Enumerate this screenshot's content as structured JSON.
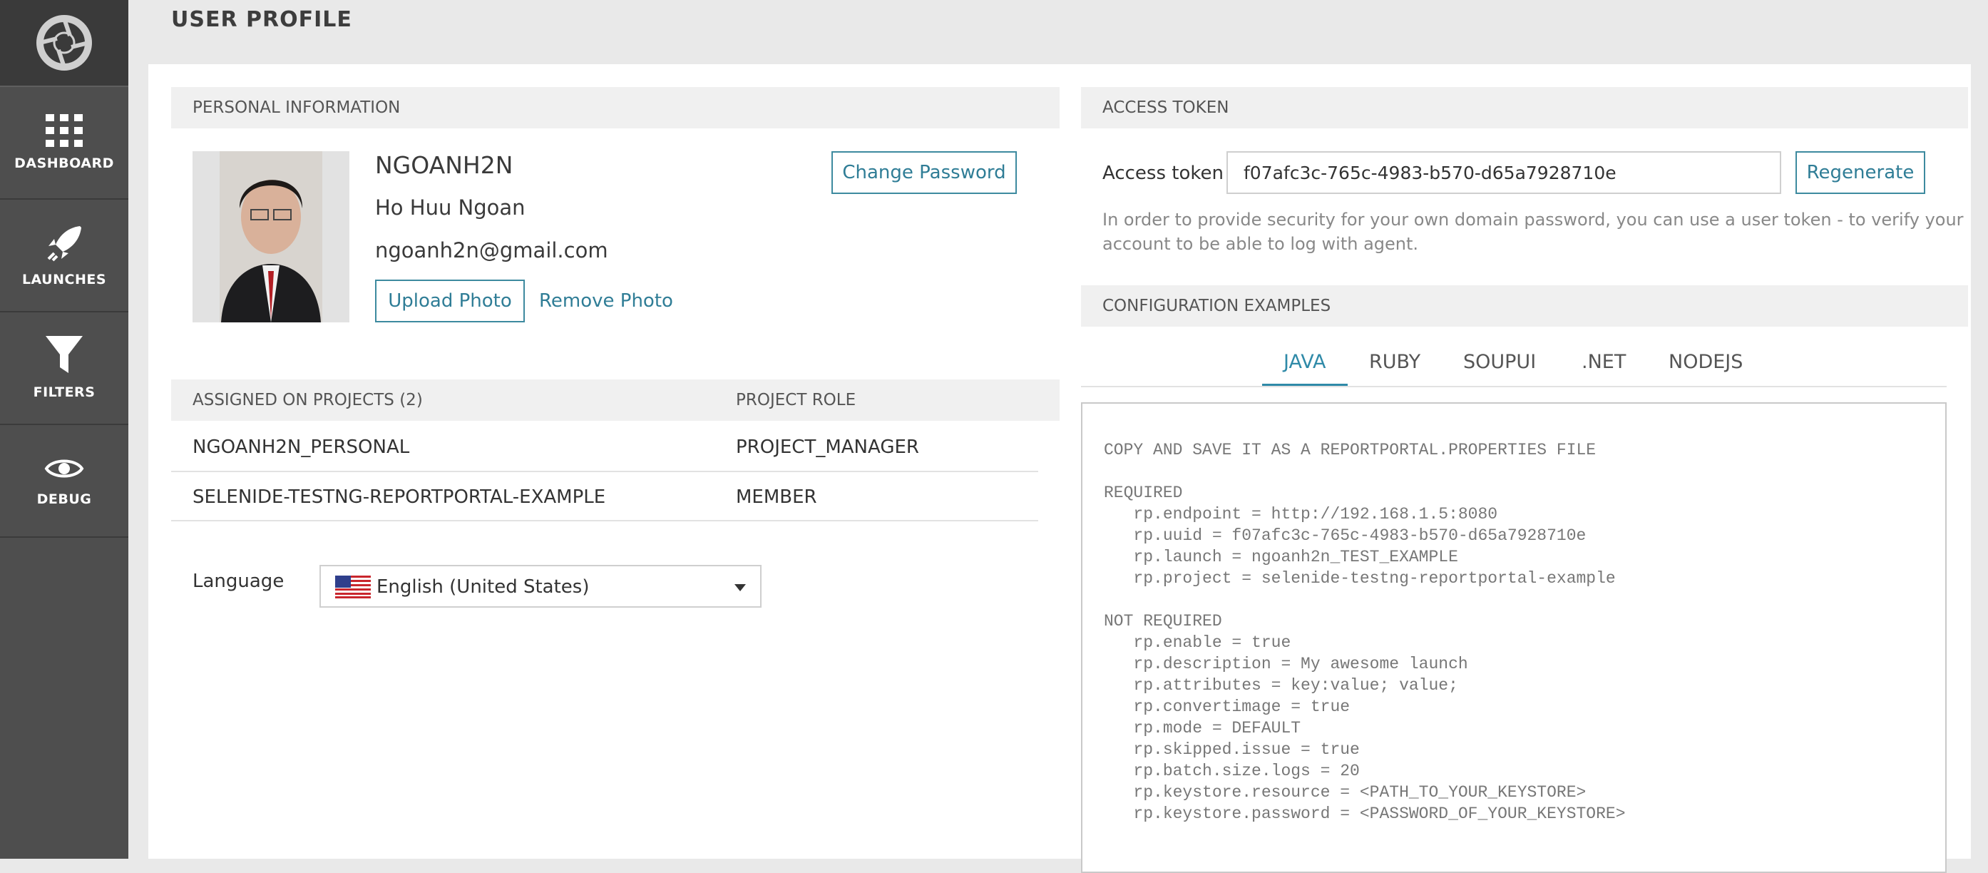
{
  "sidebar": {
    "items": [
      {
        "label": "DASHBOARD",
        "icon": "grid-icon"
      },
      {
        "label": "LAUNCHES",
        "icon": "rocket-icon"
      },
      {
        "label": "FILTERS",
        "icon": "filter-icon"
      },
      {
        "label": "DEBUG",
        "icon": "eye-icon"
      }
    ]
  },
  "header": {
    "title": "USER PROFILE"
  },
  "personal": {
    "section_title": "PERSONAL INFORMATION",
    "username": "NGOANH2N",
    "full_name": "Ho Huu Ngoan",
    "email": "ngoanh2n@gmail.com",
    "change_password": "Change Password",
    "upload_photo": "Upload Photo",
    "remove_photo": "Remove Photo"
  },
  "projects": {
    "col_project": "ASSIGNED ON PROJECTS (2)",
    "col_role": "PROJECT ROLE",
    "rows": [
      {
        "name": "NGOANH2N_PERSONAL",
        "role": "PROJECT_MANAGER"
      },
      {
        "name": "SELENIDE-TESTNG-REPORTPORTAL-EXAMPLE",
        "role": "MEMBER"
      }
    ]
  },
  "language": {
    "label": "Language",
    "value": "English (United States)"
  },
  "token": {
    "section_title": "ACCESS TOKEN",
    "label": "Access token",
    "value": "f07afc3c-765c-4983-b570-d65a7928710e",
    "regenerate": "Regenerate",
    "help_line1": "In order to provide security for your own domain password, you can use a user token - to verify your",
    "help_line2": "account to be able to log with agent."
  },
  "config": {
    "section_title": "CONFIGURATION EXAMPLES",
    "tabs": [
      "JAVA",
      "RUBY",
      "SOUPUI",
      ".NET",
      "NODEJS"
    ],
    "active_tab": "JAVA",
    "lines": [
      "COPY AND SAVE IT AS A REPORTPORTAL.PROPERTIES FILE",
      "",
      "REQUIRED",
      "   rp.endpoint = http://192.168.1.5:8080",
      "   rp.uuid = f07afc3c-765c-4983-b570-d65a7928710e",
      "   rp.launch = ngoanh2n_TEST_EXAMPLE",
      "   rp.project = selenide-testng-reportportal-example",
      "",
      "NOT REQUIRED",
      "   rp.enable = true",
      "   rp.description = My awesome launch",
      "   rp.attributes = key:value; value;",
      "   rp.convertimage = true",
      "   rp.mode = DEFAULT",
      "   rp.skipped.issue = true",
      "   rp.batch.size.logs = 20",
      "   rp.keystore.resource = <PATH_TO_YOUR_KEYSTORE>",
      "   rp.keystore.password = <PASSWORD_OF_YOUR_KEYSTORE>"
    ]
  },
  "colors": {
    "accent": "#2f7d96",
    "sidebar": "#4e4e4e"
  }
}
